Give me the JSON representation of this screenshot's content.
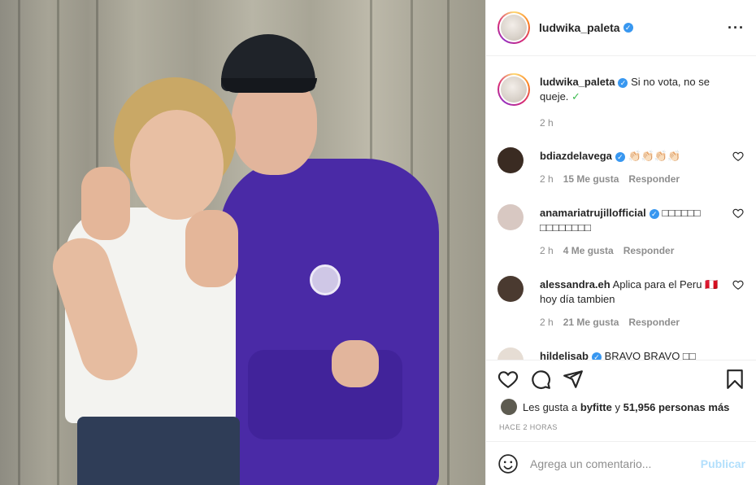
{
  "post": {
    "username": "ludwika_paleta",
    "caption": "Si no vota, no se queje.",
    "caption_emoji": "✓",
    "caption_time": "2 h"
  },
  "comments": [
    {
      "username": "bdiazdelavega",
      "text": "👏🏻👏🏻👏🏻👏🏻",
      "time": "2 h",
      "likes": "15 Me gusta",
      "reply": "Responder"
    },
    {
      "username": "anamariatrujillofficial",
      "text": "□□□□□□ □□□□□□□□",
      "time": "2 h",
      "likes": "4 Me gusta",
      "reply": "Responder"
    },
    {
      "username": "alessandra.eh",
      "text": "Aplica para el Peru 🇵🇪 hoy día tambien",
      "time": "2 h",
      "likes": "21 Me gusta",
      "reply": "Responder"
    },
    {
      "username": "hildelisab",
      "text": "BRAVO BRAVO □□"
    }
  ],
  "likes_line": {
    "prefix": "Les gusta a",
    "user": "byfitte",
    "joiner": "y",
    "count": "51,956 personas más"
  },
  "timestamp": "HACE 2 HORAS",
  "composer": {
    "placeholder": "Agrega un comentario...",
    "post_label": "Publicar"
  },
  "icons": {
    "like": "heart-icon",
    "comment": "comment-icon",
    "share": "paper-plane-icon",
    "save": "bookmark-icon",
    "emoji": "smiley-icon",
    "more": "ellipsis-icon"
  },
  "colors": {
    "verified": "#3897f0",
    "post_button_disabled": "#b2dffc",
    "hoodie": "#4a2aa6"
  }
}
